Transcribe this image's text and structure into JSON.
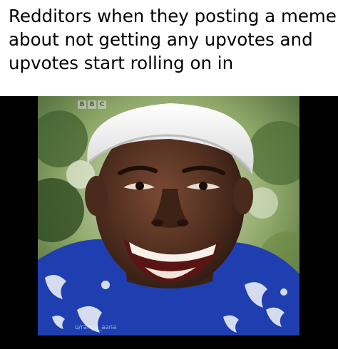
{
  "caption": {
    "lines": [
      "Redditors when they posting a meme",
      "about not getting any upvotes and",
      "upvotes start rolling on in"
    ]
  },
  "image": {
    "broadcaster_logo": [
      "B",
      "B",
      "C"
    ],
    "watermark": "u/ranga_aana"
  },
  "colors": {
    "background": "#ffffff",
    "letterbox": "#000000",
    "shirt": "#1f3fb0",
    "hat": "#f2f2f2",
    "foliage": "#5c7a3a"
  }
}
